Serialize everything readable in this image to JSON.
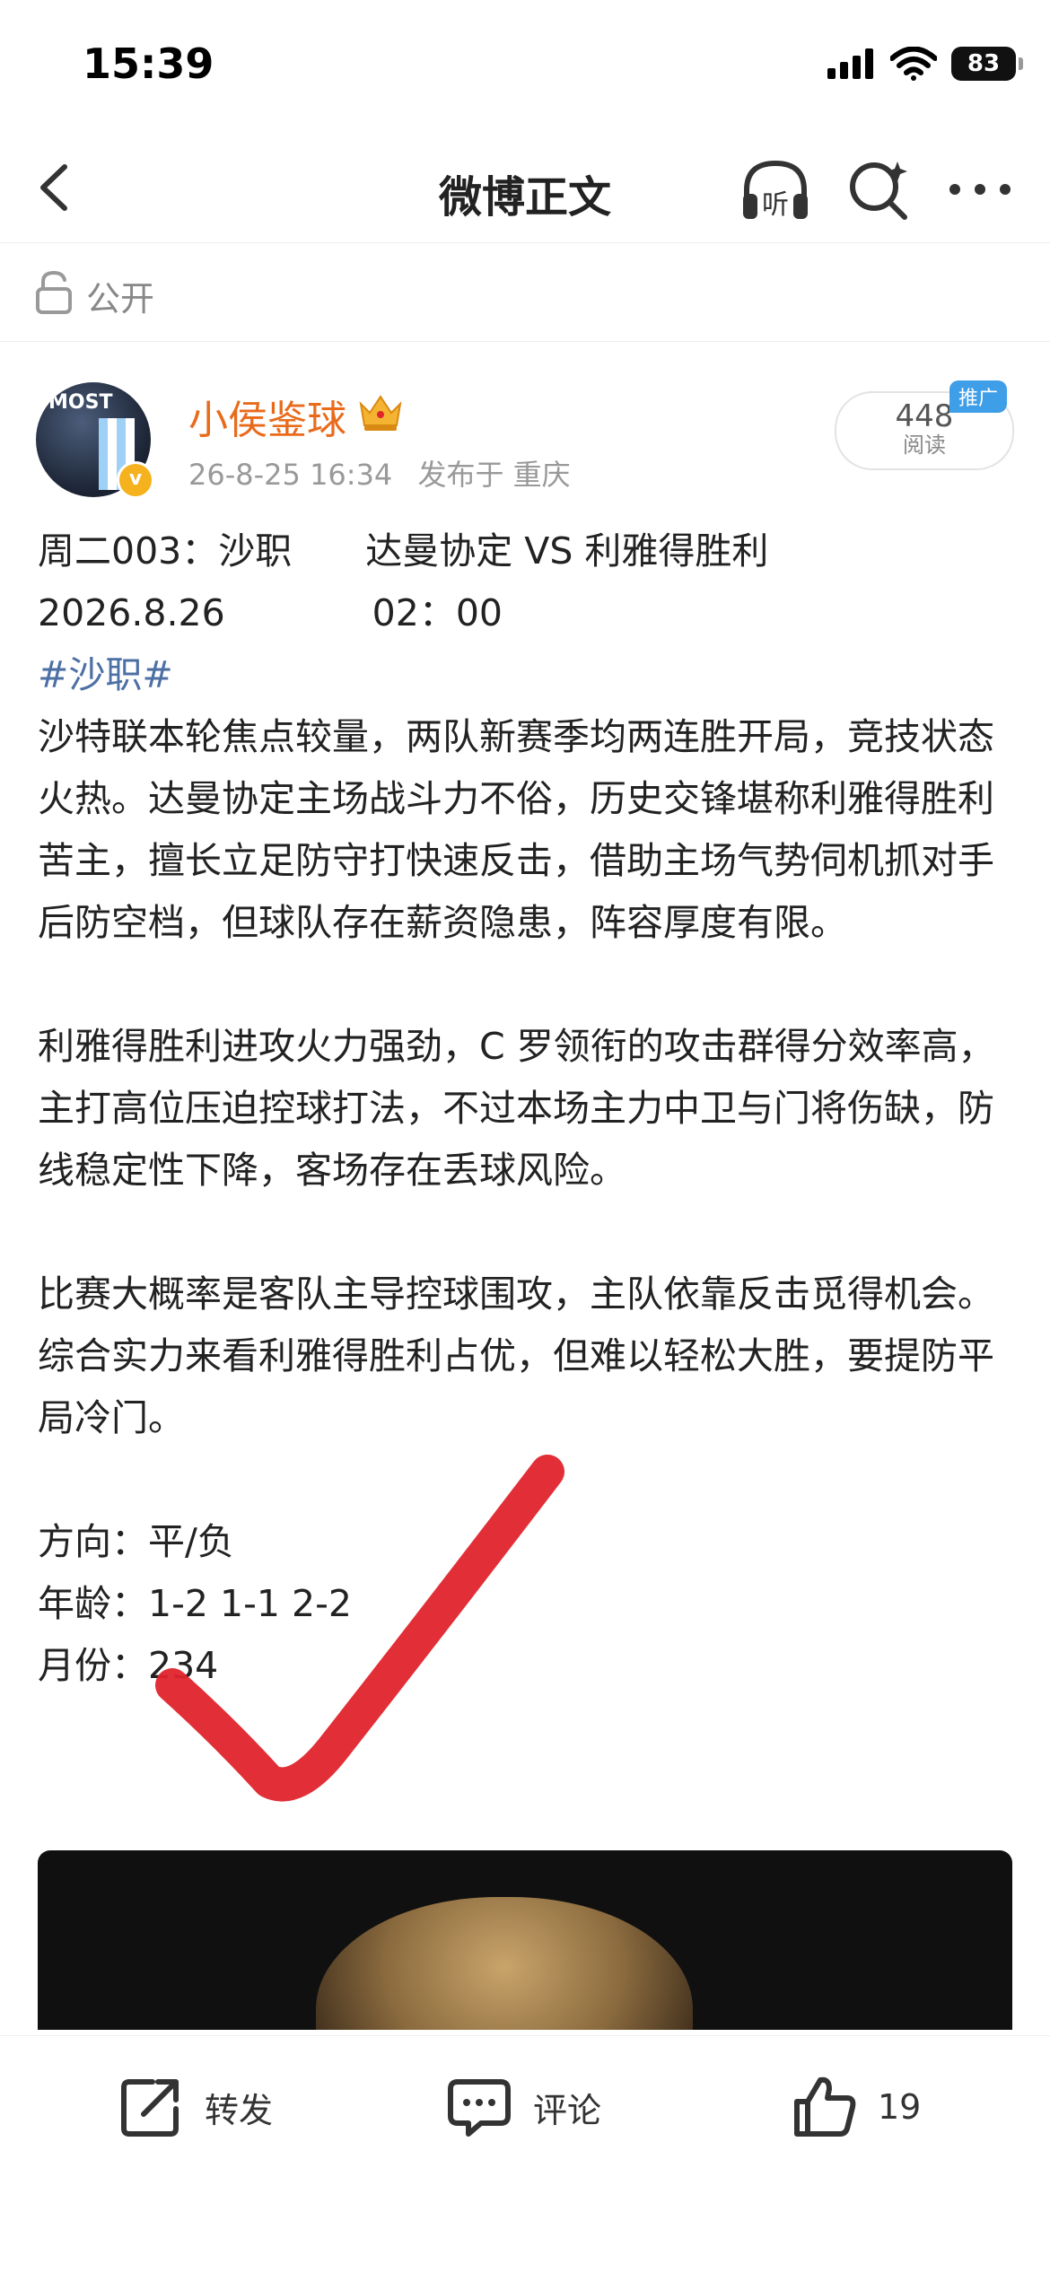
{
  "status_bar": {
    "time": "15:39",
    "battery": "83"
  },
  "nav": {
    "title": "微博正文"
  },
  "visibility": {
    "label": "公开"
  },
  "author": {
    "name": "小侯鉴球",
    "avatar_text": "MOST",
    "date": "26-8-25 16:34",
    "location": "发布于 重庆"
  },
  "stats": {
    "read_count": "448",
    "read_label": "阅读",
    "promo_tag": "推广"
  },
  "post": {
    "match_line": "周二003：沙职　　达曼协定 VS 利雅得胜利",
    "time_line": "2026.8.26　　　　02：00",
    "topic": "#沙职#",
    "paragraph_1": "沙特联本轮焦点较量，两队新赛季均两连胜开局，竞技状态火热。达曼协定主场战斗力不俗，历史交锋堪称利雅得胜利苦主，擅长立足防守打快速反击，借助主场气势伺机抓对手后防空档，但球队存在薪资隐患，阵容厚度有限。",
    "paragraph_2": "利雅得胜利进攻火力强劲，C 罗领衔的攻击群得分效率高，主打高位压迫控球打法，不过本场主力中卫与门将伤缺，防线稳定性下降，客场存在丢球风险。",
    "paragraph_3": "比赛大概率是客队主导控球围攻，主队依靠反击觅得机会。综合实力来看利雅得胜利占优，但难以轻松大胜，要提防平局冷门。",
    "direction": "方向：平/负",
    "age": "年龄：1-2 1-1 2-2",
    "month": "月份：234"
  },
  "actions": {
    "repost": "转发",
    "comment": "评论",
    "like_count": "19"
  },
  "colors": {
    "author_name": "#e86b1c",
    "topic_link": "#4c6fa4",
    "promo_tag": "#3f9ee8",
    "checkmark": "#e0242c"
  }
}
